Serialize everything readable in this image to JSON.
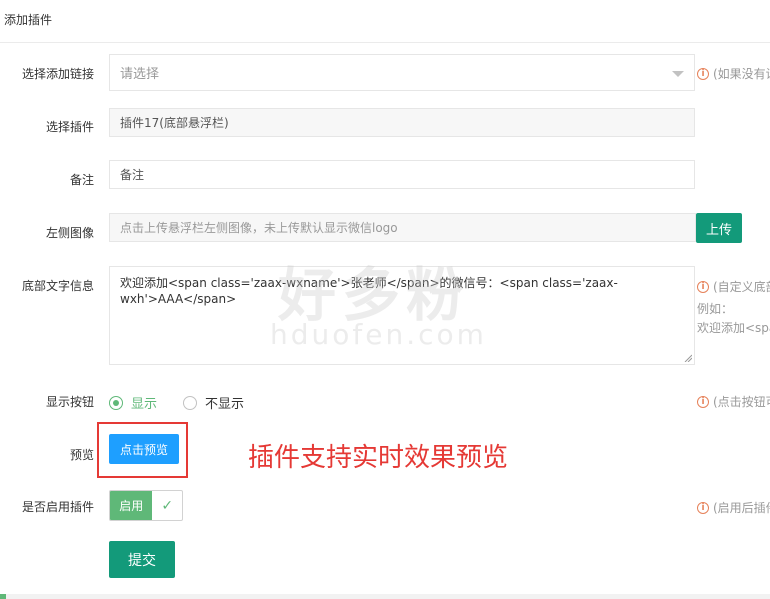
{
  "header": {
    "title": "添加插件"
  },
  "fields": {
    "link": {
      "label": "选择添加链接",
      "placeholder": "请选择",
      "hint": "(如果没有设"
    },
    "plugin": {
      "label": "选择插件",
      "value": "插件17(底部悬浮栏)"
    },
    "remark": {
      "label": "备注",
      "value": "备注"
    },
    "left_image": {
      "label": "左侧图像",
      "placeholder": "点击上传悬浮栏左侧图像，未上传默认显示微信logo",
      "upload_label": "上传"
    },
    "bottom_text": {
      "label": "底部文字信息",
      "value": "欢迎添加<span class='zaax-wxname'>张老师</span>的微信号：<span class='zaax-wxh'>AAA</span>",
      "hint_line1": "(自定义底部",
      "hint_line2": "例如：",
      "hint_line3": "欢迎添加<spa"
    },
    "show_button": {
      "label": "显示按钮",
      "option_show": "显示",
      "option_hide": "不显示",
      "selected": "显示",
      "hint": "(点击按钮可"
    },
    "preview": {
      "label": "预览",
      "button_label": "点击预览",
      "annotation": "插件支持实时效果预览"
    },
    "enable": {
      "label": "是否启用插件",
      "switch_label": "启用",
      "switch_state": "on",
      "hint": "(启用后插件"
    }
  },
  "submit_label": "提交",
  "watermark": {
    "cn": "好多粉",
    "en": "hduofen.com"
  },
  "colors": {
    "primary": "#139a7a",
    "blue": "#1e9fff",
    "green": "#5FB878",
    "hint_icon": "#e6825a",
    "annotation": "#e53935"
  }
}
